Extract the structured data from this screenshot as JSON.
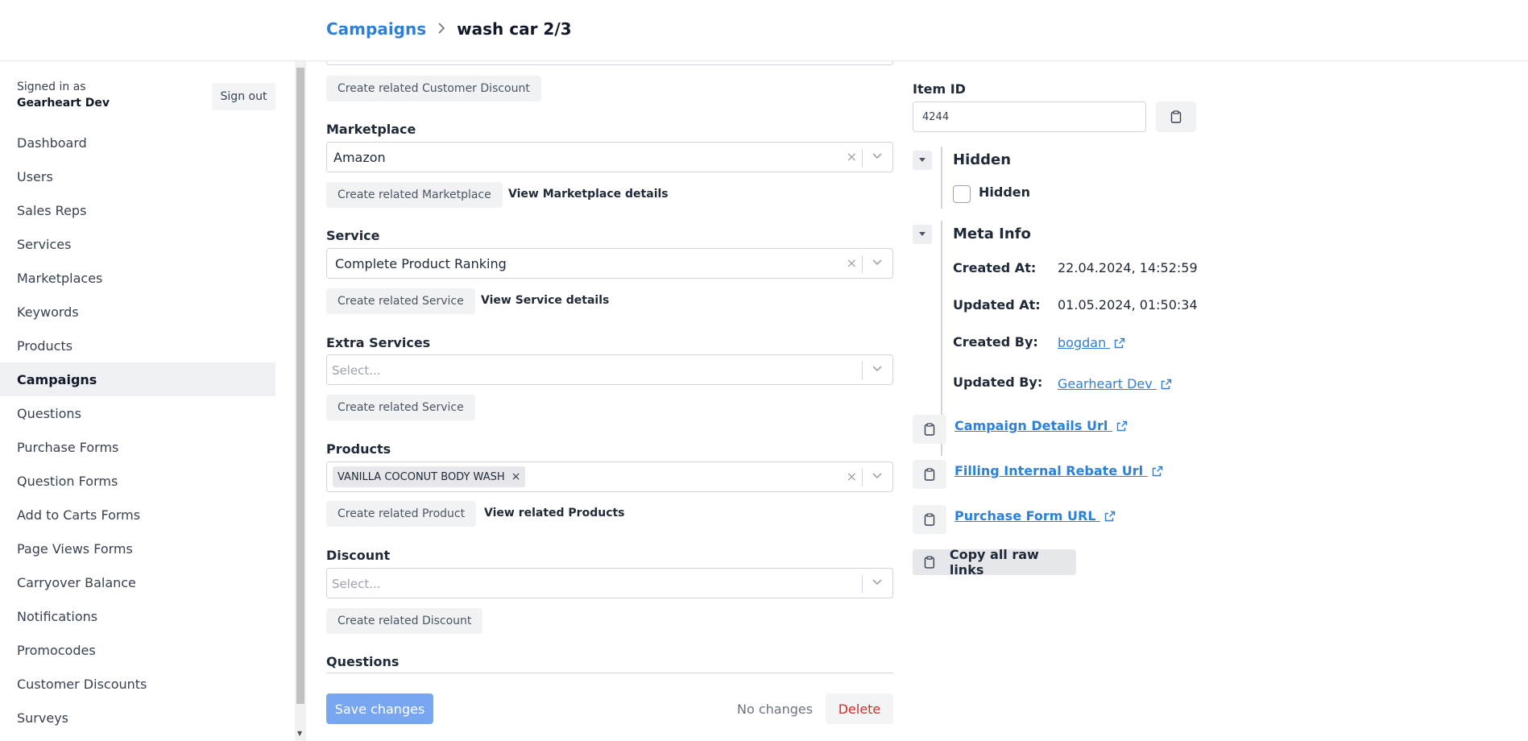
{
  "breadcrumb": {
    "parent": "Campaigns",
    "separator": ">",
    "current": "wash car 2/3"
  },
  "account": {
    "signed_in_label": "Signed in as",
    "user_name": "Gearheart Dev",
    "sign_out": "Sign out"
  },
  "nav": {
    "items": [
      {
        "label": "Dashboard"
      },
      {
        "label": "Users"
      },
      {
        "label": "Sales Reps"
      },
      {
        "label": "Services"
      },
      {
        "label": "Marketplaces"
      },
      {
        "label": "Keywords"
      },
      {
        "label": "Products"
      },
      {
        "label": "Campaigns"
      },
      {
        "label": "Questions"
      },
      {
        "label": "Purchase Forms"
      },
      {
        "label": "Question Forms"
      },
      {
        "label": "Add to Carts Forms"
      },
      {
        "label": "Page Views Forms"
      },
      {
        "label": "Carryover Balance"
      },
      {
        "label": "Notifications"
      },
      {
        "label": "Promocodes"
      },
      {
        "label": "Customer Discounts"
      },
      {
        "label": "Surveys"
      }
    ],
    "active": "Campaigns"
  },
  "form": {
    "customer_discount_create": "Create related Customer Discount",
    "marketplace": {
      "label": "Marketplace",
      "value": "Amazon",
      "create": "Create related Marketplace",
      "view": "View Marketplace details"
    },
    "service": {
      "label": "Service",
      "value": "Complete Product Ranking",
      "create": "Create related Service",
      "view": "View Service details"
    },
    "extra_services": {
      "label": "Extra Services",
      "placeholder": "Select...",
      "create": "Create related Service"
    },
    "products": {
      "label": "Products",
      "chips": [
        "VANILLA COCONUT BODY WASH"
      ],
      "chip_remove": "×",
      "create": "Create related Product",
      "view": "View related Products"
    },
    "discount": {
      "label": "Discount",
      "placeholder": "Select...",
      "create": "Create related Discount"
    },
    "questions": {
      "label": "Questions"
    },
    "clear_symbol": "×"
  },
  "footer": {
    "save": "Save changes",
    "status": "No changes",
    "delete": "Delete"
  },
  "details": {
    "item_id_label": "Item ID",
    "item_id_value": "4244",
    "hidden_section": {
      "title": "Hidden",
      "checkbox_label": "Hidden",
      "checked": false
    },
    "meta_section": {
      "title": "Meta Info",
      "created_at_label": "Created At:",
      "created_at": "22.04.2024, 14:52:59",
      "updated_at_label": "Updated At:",
      "updated_at": "01.05.2024, 01:50:34",
      "created_by_label": "Created By:",
      "created_by": "bogdan",
      "updated_by_label": "Updated By:",
      "updated_by": "Gearheart Dev"
    },
    "links": [
      {
        "label": "Campaign Details Url"
      },
      {
        "label": "Filling Internal Rebate Url"
      },
      {
        "label": "Purchase Form URL"
      }
    ],
    "copy_all": "Copy all raw links"
  },
  "colors": {
    "link": "#2f7fd6",
    "primary_button": "#78a6f0",
    "danger": "#dc2626"
  }
}
